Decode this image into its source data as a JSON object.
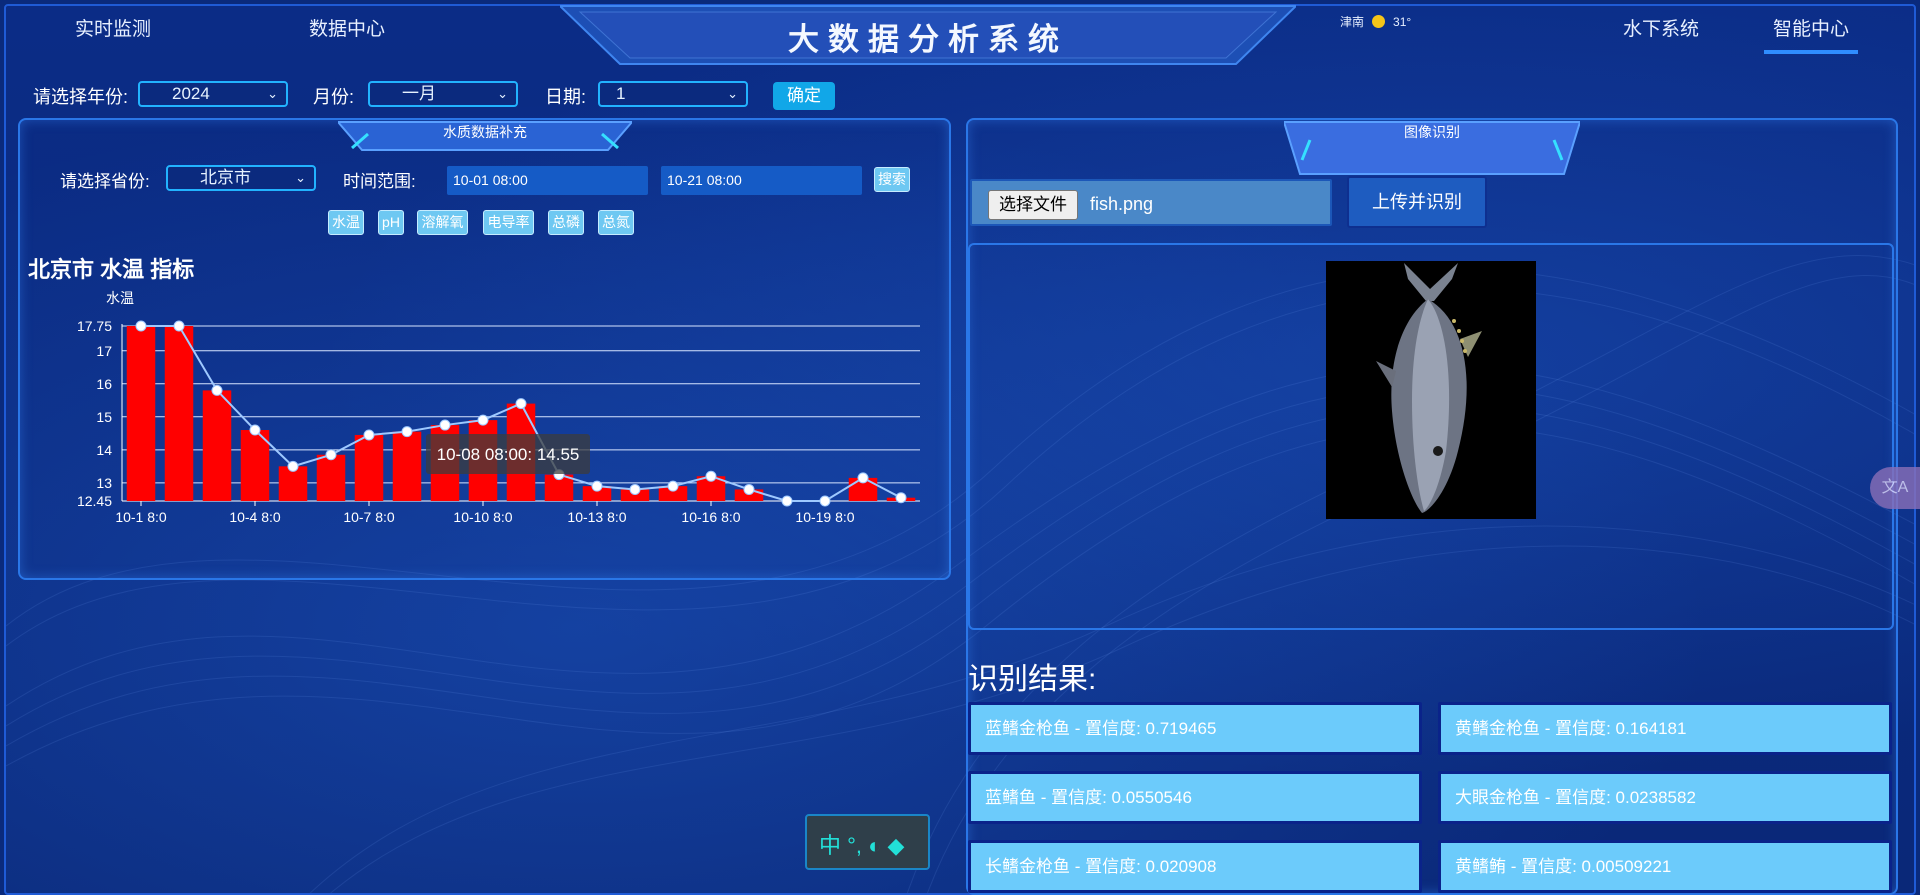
{
  "header": {
    "nav_left": [
      "实时监测",
      "数据中心"
    ],
    "title": "大数据分析系统",
    "weather": {
      "city": "津南",
      "icon": "sun-icon",
      "temp": "31°"
    },
    "nav_right": [
      "水下系统",
      "智能中心"
    ],
    "active_nav": "智能中心"
  },
  "filters": {
    "year_label": "请选择年份:",
    "year_value": "2024",
    "month_label": "月份:",
    "month_value": "一月",
    "day_label": "日期:",
    "day_value": "1",
    "confirm_label": "确定"
  },
  "left_panel": {
    "tab_title": "水质数据补充",
    "province_label": "请选择省份:",
    "province_value": "北京市",
    "time_range_label": "时间范围:",
    "time_start": "10-01 08:00",
    "time_end": "10-21 08:00",
    "search_label": "搜索",
    "indicator_buttons": [
      "水温",
      "pH",
      "溶解氧",
      "电导率",
      "总磷",
      "总氮"
    ],
    "chart_heading": "北京市 水温 指标",
    "tooltip": "10-08 08:00: 14.55"
  },
  "chart_data": {
    "type": "bar",
    "ylabel": "水温",
    "ylim": [
      12.45,
      17.75
    ],
    "yticks": [
      12.45,
      13,
      14,
      15,
      16,
      17,
      17.75
    ],
    "xtick_labels": [
      "10-1 8:0",
      "10-4 8:0",
      "10-7 8:0",
      "10-10 8:0",
      "10-13 8:0",
      "10-16 8:0",
      "10-19 8:0"
    ],
    "categories": [
      "10-1 8:0",
      "10-2 8:0",
      "10-3 8:0",
      "10-4 8:0",
      "10-5 8:0",
      "10-6 8:0",
      "10-7 8:0",
      "10-8 8:0",
      "10-9 8:0",
      "10-10 8:0",
      "10-11 8:0",
      "10-12 8:0",
      "10-13 8:0",
      "10-14 8:0",
      "10-15 8:0",
      "10-16 8:0",
      "10-17 8:0",
      "10-18 8:0",
      "10-19 8:0",
      "10-20 8:0",
      "10-21 8:0"
    ],
    "values": [
      17.75,
      17.75,
      15.8,
      14.6,
      13.5,
      13.85,
      14.45,
      14.55,
      14.75,
      14.9,
      15.4,
      13.25,
      12.9,
      12.8,
      12.9,
      13.2,
      12.8,
      12.45,
      12.45,
      13.15,
      12.55
    ],
    "bar_color": "#ff0000",
    "line_color": "#9ec9ff",
    "grid": true
  },
  "right_panel": {
    "tab_title": "图像识别",
    "choose_file_label": "选择文件",
    "file_name": "fish.png",
    "upload_label": "上传并识别",
    "result_title": "识别结果:",
    "results": [
      "蓝鳍金枪鱼 - 置信度: 0.719465",
      "黄鳍金枪鱼 - 置信度: 0.164181",
      "蓝鳍鱼 - 置信度: 0.0550546",
      "大眼金枪鱼 - 置信度: 0.0238582",
      "长鳍金枪鱼 - 置信度: 0.020908",
      "黄鳍鲔 - 置信度: 0.00509221"
    ]
  },
  "widgets": {
    "ime_text": "中 °, ◐ ◆",
    "translate_icon": "translate-icon"
  }
}
